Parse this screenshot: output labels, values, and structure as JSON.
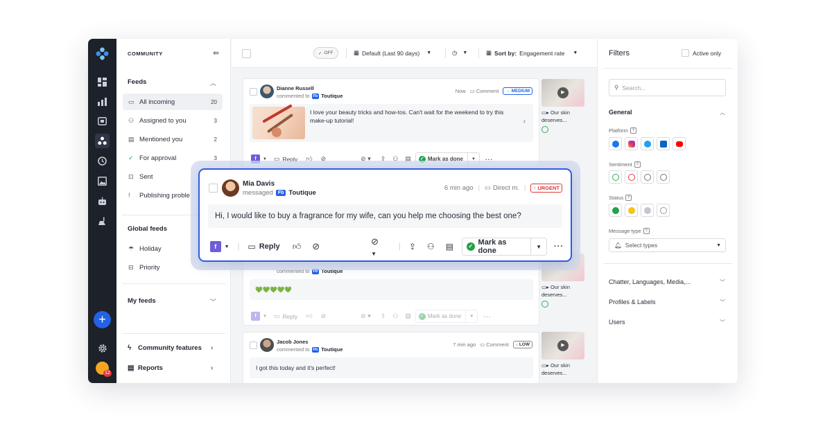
{
  "sidebar": {
    "title": "COMMUNITY",
    "feeds_label": "Feeds",
    "items": [
      {
        "label": "All incoming",
        "count": "20"
      },
      {
        "label": "Assigned to you",
        "count": "3"
      },
      {
        "label": "Mentioned you",
        "count": "2"
      },
      {
        "label": "For approval",
        "count": "3"
      },
      {
        "label": "Sent",
        "count": ""
      },
      {
        "label": "Publishing proble",
        "count": ""
      }
    ],
    "global_feeds_label": "Global feeds",
    "global_items": [
      {
        "label": "Holiday"
      },
      {
        "label": "Priority"
      }
    ],
    "my_feeds_label": "My feeds",
    "community_features_label": "Community features",
    "reports_label": "Reports",
    "avatar_badge": "12"
  },
  "topbar": {
    "toggle_label": "OFF",
    "date_range": "Default (Last 90 days)",
    "sort_prefix": "Sort by:",
    "sort_value": "Engagement rate"
  },
  "cards": [
    {
      "name": "Dianne Russell",
      "action": "commented to",
      "platform": "Fb",
      "brand": "Toutique",
      "time": "Now",
      "type": "Comment",
      "priority": "MEDIUM",
      "text": "I love your beauty tricks and how-tos. Can't wait for the weekend to try this make-up tutorial!",
      "reply": "Reply",
      "mark_done": "Mark as done"
    },
    {
      "action": "commented to",
      "platform": "Fb",
      "brand": "Toutique",
      "text": "💚💚💚💚💚",
      "reply": "Reply",
      "mark_done": "Mark as done"
    },
    {
      "name": "Jacob Jones",
      "action": "commented to",
      "platform": "Fb",
      "brand": "Toutique",
      "time": "7 min ago",
      "type": "Comment",
      "priority": "LOW",
      "text": "I got this today and it's perfect!"
    }
  ],
  "highlight": {
    "name": "Mia Davis",
    "action": "messaged",
    "platform": "Fb",
    "brand": "Toutique",
    "time": "6 min ago",
    "type": "Direct m.",
    "priority": "URGENT",
    "text": "Hi, I would like to buy a fragrance for my wife, can you help me choosing the best one?",
    "reply": "Reply",
    "mark_done": "Mark as done"
  },
  "thumbs": [
    {
      "caption_line1": "Our skin",
      "caption_line2": "deserves..."
    },
    {
      "caption_line1": "Our skin",
      "caption_line2": "deserves..."
    },
    {
      "caption_line1": "Our skin",
      "caption_line2": "deserves..."
    }
  ],
  "filters": {
    "title": "Filters",
    "active_only": "Active only",
    "search_placeholder": "Search...",
    "general": "General",
    "platform_label": "Platform",
    "sentiment_label": "Sentiment",
    "status_label": "Status",
    "message_type_label": "Message type",
    "select_types": "Select types",
    "accordions": [
      {
        "label": "Chatter, Languages, Media,..."
      },
      {
        "label": "Profiles & Labels"
      },
      {
        "label": "Users"
      }
    ]
  },
  "colors": {
    "accent": "#2362e7",
    "highlight_border": "#2f5be0",
    "urgent": "#d93a3a",
    "done_green": "#22a24a",
    "rail": "#1d2129"
  }
}
